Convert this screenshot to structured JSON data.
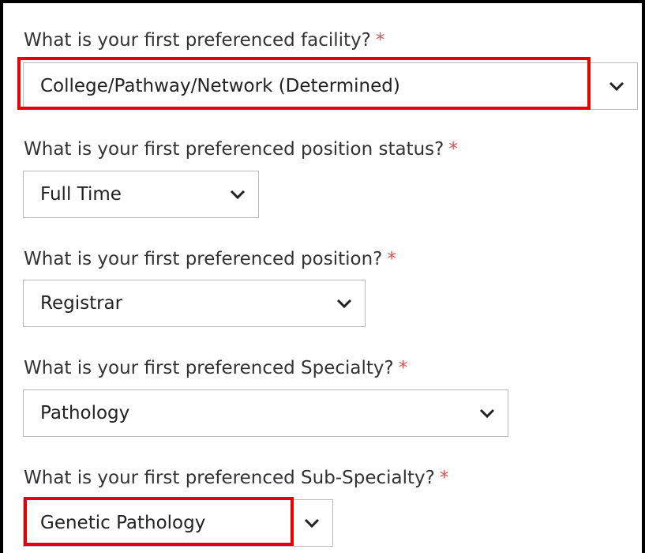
{
  "required_marker": "*",
  "questions": [
    {
      "label": "What is your first preferenced facility?",
      "value": "College/Pathway/Network (Determined)"
    },
    {
      "label": "What is your first preferenced position status?",
      "value": "Full Time"
    },
    {
      "label": "What is your first preferenced position?",
      "value": "Registrar"
    },
    {
      "label": "What is your first preferenced Specialty?",
      "value": "Pathology"
    },
    {
      "label": "What is your first preferenced Sub-Specialty?",
      "value": "Genetic Pathology"
    }
  ],
  "icons": {
    "dropdown": "chevron-down-icon"
  },
  "colors": {
    "required": "#d9534f",
    "highlight": "#e60000",
    "frame": "#000000"
  }
}
